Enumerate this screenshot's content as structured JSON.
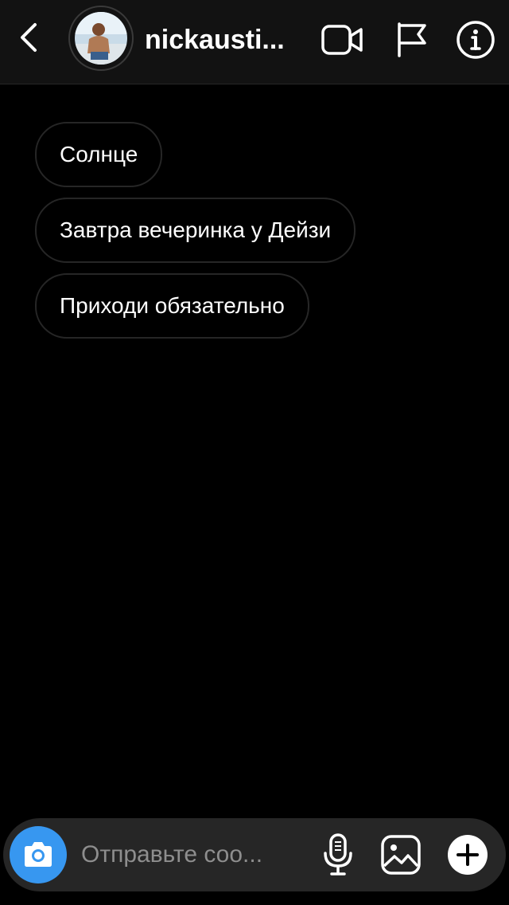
{
  "header": {
    "username": "nickausti...",
    "icons": {
      "back": "chevron-left-icon",
      "video": "video-camera-icon",
      "report": "flag-icon",
      "info": "info-icon"
    }
  },
  "messages": [
    {
      "text": "Солнце"
    },
    {
      "text": "Завтра вечеринка у Дейзи"
    },
    {
      "text": "Приходи обязательно"
    }
  ],
  "composer": {
    "placeholder": "Отправьте соо...",
    "icons": {
      "camera": "camera-icon",
      "mic": "microphone-icon",
      "gallery": "gallery-icon",
      "more": "plus-icon"
    }
  },
  "colors": {
    "background": "#000000",
    "header_bg": "#121212",
    "bubble_border": "#262626",
    "composer_bg": "#262626",
    "accent": "#3797f0",
    "placeholder": "#8e8e8e"
  }
}
